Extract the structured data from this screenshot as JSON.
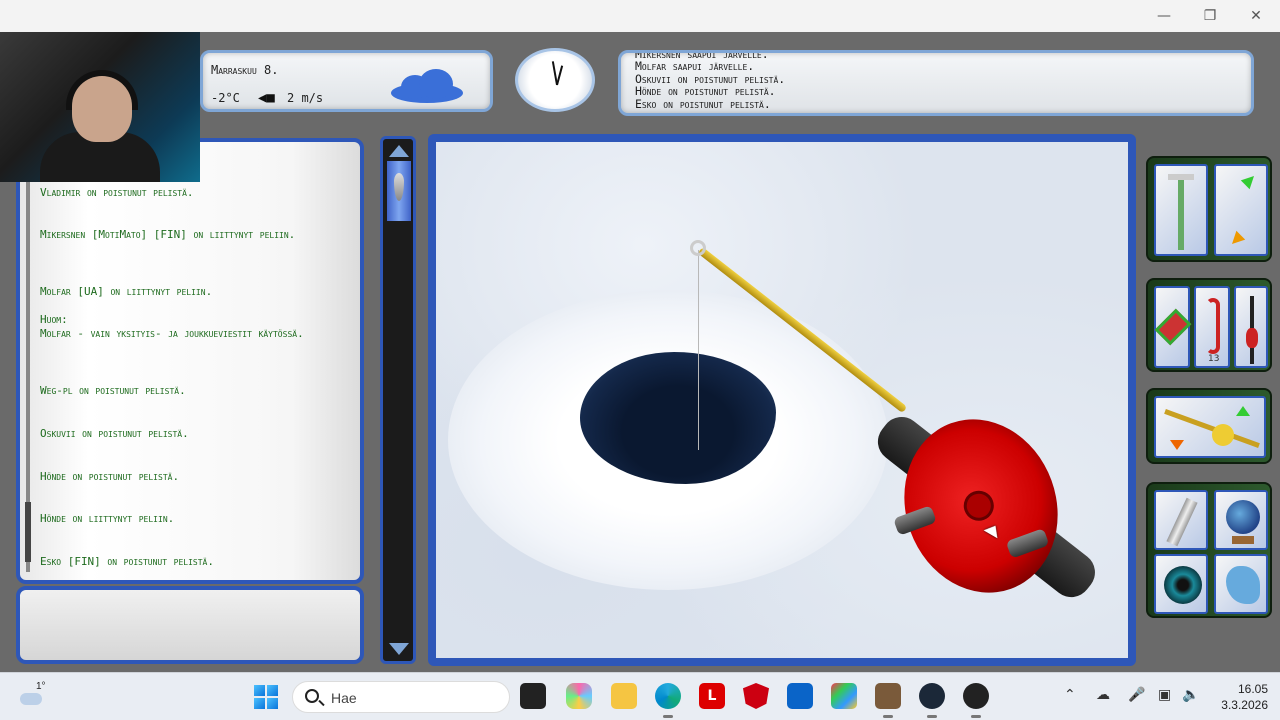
{
  "window": {
    "minimize_icon": "minimize-icon",
    "restore_icon": "restore-icon",
    "close_icon": "close-icon"
  },
  "weather": {
    "date": "Marraskuu 8.",
    "temperature": "-2°C",
    "wind_speed": "2 m/s",
    "wind_direction_icon": "arrow-left-icon",
    "sky_icon": "cloud-icon"
  },
  "news": [
    "Mikersnen saapui järvelle.",
    "Molfar saapui järvelle.",
    "Oskuvii on poistunut pelistä.",
    "Hönde on poistunut pelistä.",
    "Esko on poistunut pelistä."
  ],
  "chat": {
    "messages": [
      "Vladimir on poistunut pelistä.",
      "Mikersnen [MotiMato] [FIN] on liittynyt peliin.",
      "Molfar [UA] on liittynyt peliin.",
      "Huom:\nMolfar - vain yksityis- ja joukkueviestit käytössä.",
      "Weg-pl on poistunut pelistä.",
      "Oskuvii on poistunut pelistä.",
      "Hönde on poistunut pelistä.",
      "Hönde on liittynyt peliin.",
      "Esko [FIN] on poistunut pelistä."
    ]
  },
  "tools": {
    "panel1": [
      "ice-auger-icon",
      "swap-arrows-icon"
    ],
    "panel2": [
      "lure-icon",
      "worm-icon",
      "float-icon"
    ],
    "panel2_count": "13",
    "panel3": [
      "fishing-rod-icon"
    ],
    "panel4": [
      "flashlight-icon",
      "globe-icon",
      "sonar-icon",
      "map-icon"
    ]
  },
  "taskbar": {
    "temperature": "1°",
    "search_placeholder": "Hae",
    "apps": [
      {
        "name": "file-explorer-icon",
        "label": ""
      },
      {
        "name": "copilot-icon",
        "label": ""
      },
      {
        "name": "folder-icon",
        "label": ""
      },
      {
        "name": "edge-icon",
        "label": ""
      },
      {
        "name": "l-app-icon",
        "label": "L"
      },
      {
        "name": "mcafee-icon",
        "label": ""
      },
      {
        "name": "outlook-icon",
        "label": ""
      },
      {
        "name": "store-icon",
        "label": ""
      },
      {
        "name": "game-icon",
        "label": ""
      },
      {
        "name": "steam-icon",
        "label": ""
      },
      {
        "name": "obs-icon",
        "label": ""
      }
    ],
    "time": "16.05",
    "date": "3.3.2026"
  }
}
